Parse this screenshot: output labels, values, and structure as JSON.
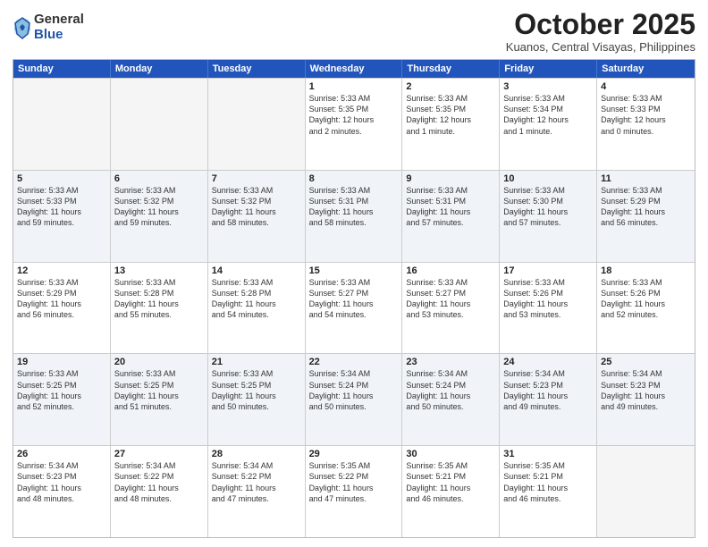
{
  "logo": {
    "general": "General",
    "blue": "Blue"
  },
  "header": {
    "month": "October 2025",
    "location": "Kuanos, Central Visayas, Philippines"
  },
  "weekdays": [
    "Sunday",
    "Monday",
    "Tuesday",
    "Wednesday",
    "Thursday",
    "Friday",
    "Saturday"
  ],
  "rows": [
    [
      {
        "day": "",
        "info": ""
      },
      {
        "day": "",
        "info": ""
      },
      {
        "day": "",
        "info": ""
      },
      {
        "day": "1",
        "info": "Sunrise: 5:33 AM\nSunset: 5:35 PM\nDaylight: 12 hours\nand 2 minutes."
      },
      {
        "day": "2",
        "info": "Sunrise: 5:33 AM\nSunset: 5:35 PM\nDaylight: 12 hours\nand 1 minute."
      },
      {
        "day": "3",
        "info": "Sunrise: 5:33 AM\nSunset: 5:34 PM\nDaylight: 12 hours\nand 1 minute."
      },
      {
        "day": "4",
        "info": "Sunrise: 5:33 AM\nSunset: 5:33 PM\nDaylight: 12 hours\nand 0 minutes."
      }
    ],
    [
      {
        "day": "5",
        "info": "Sunrise: 5:33 AM\nSunset: 5:33 PM\nDaylight: 11 hours\nand 59 minutes."
      },
      {
        "day": "6",
        "info": "Sunrise: 5:33 AM\nSunset: 5:32 PM\nDaylight: 11 hours\nand 59 minutes."
      },
      {
        "day": "7",
        "info": "Sunrise: 5:33 AM\nSunset: 5:32 PM\nDaylight: 11 hours\nand 58 minutes."
      },
      {
        "day": "8",
        "info": "Sunrise: 5:33 AM\nSunset: 5:31 PM\nDaylight: 11 hours\nand 58 minutes."
      },
      {
        "day": "9",
        "info": "Sunrise: 5:33 AM\nSunset: 5:31 PM\nDaylight: 11 hours\nand 57 minutes."
      },
      {
        "day": "10",
        "info": "Sunrise: 5:33 AM\nSunset: 5:30 PM\nDaylight: 11 hours\nand 57 minutes."
      },
      {
        "day": "11",
        "info": "Sunrise: 5:33 AM\nSunset: 5:29 PM\nDaylight: 11 hours\nand 56 minutes."
      }
    ],
    [
      {
        "day": "12",
        "info": "Sunrise: 5:33 AM\nSunset: 5:29 PM\nDaylight: 11 hours\nand 56 minutes."
      },
      {
        "day": "13",
        "info": "Sunrise: 5:33 AM\nSunset: 5:28 PM\nDaylight: 11 hours\nand 55 minutes."
      },
      {
        "day": "14",
        "info": "Sunrise: 5:33 AM\nSunset: 5:28 PM\nDaylight: 11 hours\nand 54 minutes."
      },
      {
        "day": "15",
        "info": "Sunrise: 5:33 AM\nSunset: 5:27 PM\nDaylight: 11 hours\nand 54 minutes."
      },
      {
        "day": "16",
        "info": "Sunrise: 5:33 AM\nSunset: 5:27 PM\nDaylight: 11 hours\nand 53 minutes."
      },
      {
        "day": "17",
        "info": "Sunrise: 5:33 AM\nSunset: 5:26 PM\nDaylight: 11 hours\nand 53 minutes."
      },
      {
        "day": "18",
        "info": "Sunrise: 5:33 AM\nSunset: 5:26 PM\nDaylight: 11 hours\nand 52 minutes."
      }
    ],
    [
      {
        "day": "19",
        "info": "Sunrise: 5:33 AM\nSunset: 5:25 PM\nDaylight: 11 hours\nand 52 minutes."
      },
      {
        "day": "20",
        "info": "Sunrise: 5:33 AM\nSunset: 5:25 PM\nDaylight: 11 hours\nand 51 minutes."
      },
      {
        "day": "21",
        "info": "Sunrise: 5:33 AM\nSunset: 5:25 PM\nDaylight: 11 hours\nand 50 minutes."
      },
      {
        "day": "22",
        "info": "Sunrise: 5:34 AM\nSunset: 5:24 PM\nDaylight: 11 hours\nand 50 minutes."
      },
      {
        "day": "23",
        "info": "Sunrise: 5:34 AM\nSunset: 5:24 PM\nDaylight: 11 hours\nand 50 minutes."
      },
      {
        "day": "24",
        "info": "Sunrise: 5:34 AM\nSunset: 5:23 PM\nDaylight: 11 hours\nand 49 minutes."
      },
      {
        "day": "25",
        "info": "Sunrise: 5:34 AM\nSunset: 5:23 PM\nDaylight: 11 hours\nand 49 minutes."
      }
    ],
    [
      {
        "day": "26",
        "info": "Sunrise: 5:34 AM\nSunset: 5:23 PM\nDaylight: 11 hours\nand 48 minutes."
      },
      {
        "day": "27",
        "info": "Sunrise: 5:34 AM\nSunset: 5:22 PM\nDaylight: 11 hours\nand 48 minutes."
      },
      {
        "day": "28",
        "info": "Sunrise: 5:34 AM\nSunset: 5:22 PM\nDaylight: 11 hours\nand 47 minutes."
      },
      {
        "day": "29",
        "info": "Sunrise: 5:35 AM\nSunset: 5:22 PM\nDaylight: 11 hours\nand 47 minutes."
      },
      {
        "day": "30",
        "info": "Sunrise: 5:35 AM\nSunset: 5:21 PM\nDaylight: 11 hours\nand 46 minutes."
      },
      {
        "day": "31",
        "info": "Sunrise: 5:35 AM\nSunset: 5:21 PM\nDaylight: 11 hours\nand 46 minutes."
      },
      {
        "day": "",
        "info": ""
      }
    ]
  ]
}
